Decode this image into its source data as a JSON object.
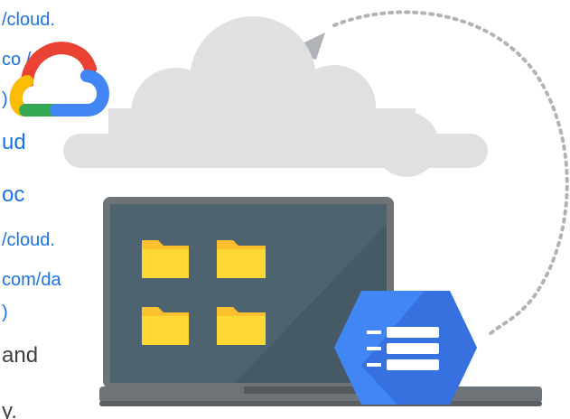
{
  "colors": {
    "link": "#1a73e8",
    "text": "#3c4043",
    "cloud": "#e0e0e0",
    "arrow": "#b0b4b8",
    "laptop_body": "#6e7378",
    "laptop_screen": "#455a64",
    "folder": "#fbc02d",
    "hexagon": "#4285f4",
    "google_red": "#ea4335",
    "google_yellow": "#fbbc04",
    "google_green": "#34a853",
    "google_blue": "#4285f4"
  },
  "icons": {
    "google_cloud_logo": "google-cloud-logo-icon",
    "folder": "folder-icon",
    "storage_hexagon": "cloud-storage-icon",
    "sync_arrow": "circular-arrow-icon"
  },
  "text_fragments": [
    {
      "id": "f1",
      "text": "/cloud.",
      "style": "link-sm"
    },
    {
      "id": "f2",
      "text": "co  /p",
      "style": "link-sm"
    },
    {
      "id": "f3",
      "text": ")",
      "style": "link-sm"
    },
    {
      "id": "f4",
      "text": "ud",
      "style": "link-lg"
    },
    {
      "id": "f5",
      "text": "oc",
      "style": "link-lg"
    },
    {
      "id": "f6",
      "text": "/cloud.",
      "style": "link-sm"
    },
    {
      "id": "f7",
      "text": "com/da",
      "style": "link-sm"
    },
    {
      "id": "f8",
      "text": ")",
      "style": "link-sm"
    },
    {
      "id": "f9",
      "text": "and",
      "style": "plain"
    },
    {
      "id": "f10",
      "text": "y.",
      "style": "plain"
    }
  ]
}
